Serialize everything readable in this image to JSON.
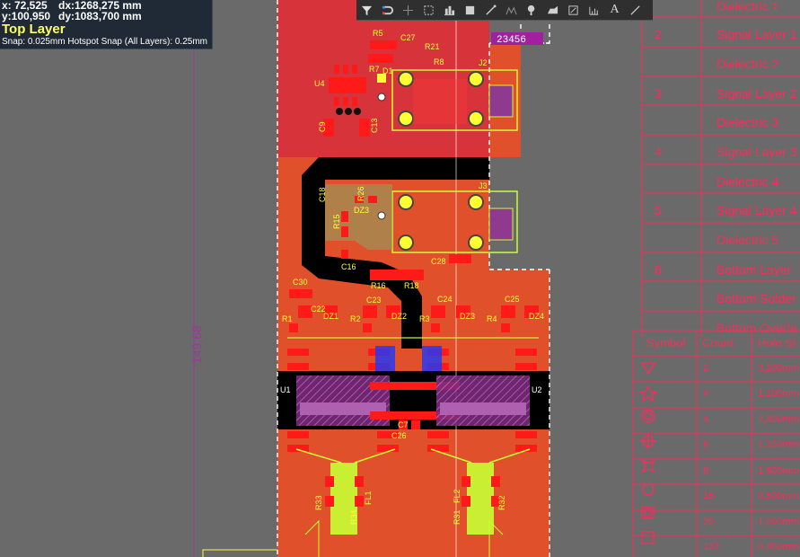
{
  "coords": {
    "x": "x: 72,525",
    "y": "y:100,950",
    "dx": "dx:1268,275 mm",
    "dy": "dy:1083,700 mm",
    "layer": "Top Layer",
    "snap": "Snap: 0.025mm Hotspot Snap (All Layers): 0.25mm"
  },
  "toolbar": {
    "buttons": [
      {
        "name": "filter-icon"
      },
      {
        "name": "route-icon"
      },
      {
        "name": "crosshair-icon"
      },
      {
        "name": "select-rect-icon"
      },
      {
        "name": "align-icon"
      },
      {
        "name": "place-component-icon"
      },
      {
        "name": "interactive-route-icon"
      },
      {
        "name": "diff-pair-icon"
      },
      {
        "name": "via-icon"
      },
      {
        "name": "polygon-icon"
      },
      {
        "name": "region-icon"
      },
      {
        "name": "dimension-icon"
      },
      {
        "name": "text-icon"
      },
      {
        "name": "line-icon"
      }
    ],
    "text_tool_glyph": "A"
  },
  "dimension_label": "149,68",
  "layer_tag": "23456",
  "stackup": {
    "rows": [
      {
        "num": "",
        "name": "Dielectric 1"
      },
      {
        "num": "2",
        "name": "Signal Layer 1"
      },
      {
        "num": "",
        "name": "Dielectric 2"
      },
      {
        "num": "3",
        "name": "Signal Layer 2"
      },
      {
        "num": "",
        "name": "Dielectric 3"
      },
      {
        "num": "4",
        "name": "Signal Layer 3"
      },
      {
        "num": "",
        "name": "Dielectric 4"
      },
      {
        "num": "5",
        "name": "Signal Layer 4"
      },
      {
        "num": "",
        "name": "Dielectric 5"
      },
      {
        "num": "6",
        "name": "Bottom Layer"
      },
      {
        "num": "",
        "name": "Bottom Solder"
      },
      {
        "num": "",
        "name": "Bottom Overla"
      }
    ]
  },
  "drill_table": {
    "headers": {
      "symbol": "Symbol",
      "count": "Count",
      "hole": "Hole Si"
    },
    "rows": [
      {
        "symbol": "triangle-down",
        "count": "2",
        "hole": "3,200mm"
      },
      {
        "symbol": "star",
        "count": "4",
        "hole": "1,100mm"
      },
      {
        "symbol": "double-circle",
        "count": "4",
        "hole": "2,800mm"
      },
      {
        "symbol": "circle-cross",
        "count": "8",
        "hole": "1,350mm"
      },
      {
        "symbol": "concave-square",
        "count": "8",
        "hole": "1,600mm"
      },
      {
        "symbol": "circle",
        "count": "16",
        "hole": "0,500mm"
      },
      {
        "symbol": "double-square",
        "count": "20",
        "hole": "1,000mm"
      },
      {
        "symbol": "square",
        "count": "137",
        "hole": "0,350mm"
      }
    ]
  },
  "designators": {
    "R5": "R5",
    "C27": "C27",
    "R21": "R21",
    "R8": "R8",
    "R7": "R7",
    "D1": "D1",
    "U4": "U4",
    "J2": "J2",
    "C9": "C9",
    "C13": "C13",
    "C18": "C18",
    "R26": "R26",
    "DZ3": "DZ3",
    "R15": "R15",
    "J3": "J3",
    "C16": "C16",
    "C28": "C28",
    "R16": "R16",
    "R18": "R18",
    "C30": "C30",
    "C22": "C22",
    "DZ1": "DZ1",
    "R1": "R1",
    "C23": "C23",
    "R2": "R2",
    "DZ2": "DZ2",
    "C24": "C24",
    "R3": "R3",
    "DZ3b": "DZ3",
    "C25": "C25",
    "R4": "R4",
    "DZ4": "DZ4",
    "U1": "U1",
    "U2": "U2",
    "C7": "C7",
    "C26": "C26",
    "R33": "R33",
    "R34": "R34",
    "FL1": "FL1",
    "R31": "R31",
    "FL2": "FL2",
    "R32": "R32"
  },
  "colors": {
    "board_orange": "#e0512b",
    "board_red": "#d7333a",
    "pad_red": "#ff1a1a",
    "silk_yellow": "#ffff33",
    "outline_yellow": "#c6ff33",
    "keepout_magenta": "#8f3a8f",
    "cutout_black": "#000000",
    "stack_red": "#ff2a5a"
  }
}
